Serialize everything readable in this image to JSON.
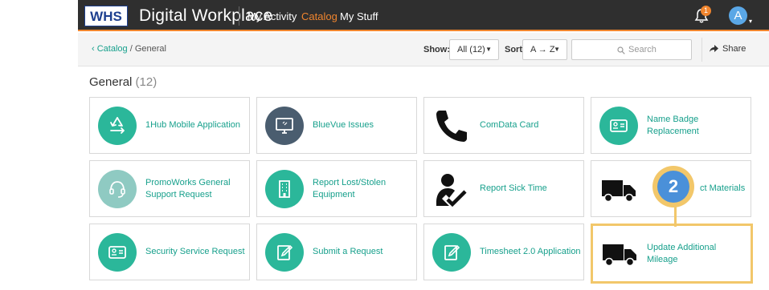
{
  "app": {
    "title": "Digital Workplace",
    "logo_text": "WHS"
  },
  "nav": {
    "items": [
      {
        "label": "My Activity"
      },
      {
        "label": "Catalog"
      },
      {
        "label": "My Stuff"
      }
    ],
    "active": "Catalog"
  },
  "notifications": {
    "count": "1"
  },
  "user": {
    "initial": "A"
  },
  "breadcrumb": {
    "parent": "‹ Catalog",
    "separator": " / ",
    "current": "General"
  },
  "toolbar": {
    "show_label": "Show:",
    "show_value": "All (12)",
    "sort_label": "Sort:",
    "sort_value": "A → Z",
    "search_placeholder": "Search",
    "share_label": "Share"
  },
  "section": {
    "title": "General",
    "count": "(12)"
  },
  "tiles": [
    {
      "label": "1Hub Mobile Application",
      "icon": "recycle-icon"
    },
    {
      "label": "BlueVue Issues",
      "icon": "monitor-icon"
    },
    {
      "label": "ComData Card",
      "icon": "phone-icon"
    },
    {
      "label": "Name Badge Replacement",
      "icon": "id-card-icon"
    },
    {
      "label": "PromoWorks General Support Request",
      "icon": "headset-icon"
    },
    {
      "label": "Report Lost/Stolen Equipment",
      "icon": "building-icon"
    },
    {
      "label": "Report Sick Time",
      "icon": "user-check-icon"
    },
    {
      "label": "ct Materials",
      "icon": "truck-icon"
    },
    {
      "label": "Security Service Request",
      "icon": "id-card-icon"
    },
    {
      "label": "Submit a Request",
      "icon": "edit-icon"
    },
    {
      "label": "Timesheet 2.0 Application",
      "icon": "edit-icon"
    },
    {
      "label": "Update Additional Mileage",
      "icon": "truck-icon"
    }
  ],
  "callout": {
    "step": "2"
  },
  "colors": {
    "accent": "#f0852e",
    "link": "#17a08c",
    "highlight": "#f2c76a",
    "badge": "#4a90d9"
  }
}
